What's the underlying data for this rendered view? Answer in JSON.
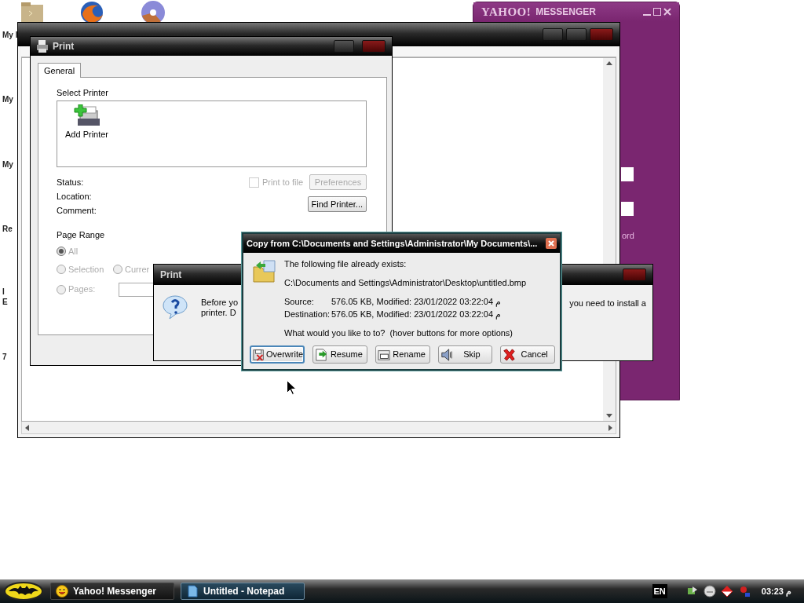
{
  "desktop": {
    "icon_labels": [
      "My I",
      "My",
      "My",
      "Re",
      "I",
      "E",
      "7"
    ]
  },
  "messenger_window": {
    "brand": "YAHOO!",
    "product": "MESSENGER",
    "link_fragment": "ord"
  },
  "print_window": {
    "title": "Print",
    "tabs": [
      {
        "label": "General",
        "selected": true
      }
    ],
    "select_printer_label": "Select Printer",
    "printers": [
      {
        "name": "Add Printer"
      }
    ],
    "info_labels": [
      "Status:",
      "Location:",
      "Comment:"
    ],
    "print_to_file": {
      "label": "Print to file",
      "checked": false,
      "disabled": true
    },
    "buttons": [
      {
        "label": "Preferences",
        "disabled": true
      },
      {
        "label": "Find Printer...",
        "disabled": false
      }
    ],
    "page_range": {
      "title": "Page Range",
      "disabled": true,
      "options": [
        {
          "label": "All",
          "selected": true
        },
        {
          "label": "Selection",
          "selected": false
        },
        {
          "label": "Currer",
          "selected": false
        },
        {
          "label": "Pages:",
          "selected": false
        }
      ]
    }
  },
  "print_message": {
    "title": "Print",
    "text_left": [
      "Before yo",
      "printer. D"
    ],
    "text_right": "you need to install a"
  },
  "copy_dialog": {
    "title": "Copy from C:\\Documents and Settings\\Administrator\\My Documents\\...",
    "heading": "The following file already exists:",
    "path": "C:\\Documents and Settings\\Administrator\\Desktop\\untitled.bmp",
    "details": [
      {
        "label": "Source:",
        "value": "576.05 KB, Modified: 23/01/2022 03:22:04 م"
      },
      {
        "label": "Destination:",
        "value": "576.05 KB, Modified: 23/01/2022 03:22:04 م"
      }
    ],
    "question": "What would you like to to?  (hover buttons for more options)",
    "buttons": [
      {
        "label": "Overwrite",
        "kind": "overwrite",
        "focused": true
      },
      {
        "label": "Resume",
        "kind": "resume",
        "focused": false
      },
      {
        "label": "Rename",
        "kind": "rename",
        "focused": false
      },
      {
        "label": "Skip",
        "kind": "skip",
        "focused": false
      },
      {
        "label": "Cancel",
        "kind": "cancel",
        "focused": false
      }
    ]
  },
  "taskbar": {
    "tasks": [
      {
        "label": "Yahoo! Messenger",
        "kind": "messenger",
        "selected": false
      },
      {
        "label": "Untitled - Notepad",
        "kind": "notepad",
        "selected": true
      }
    ],
    "language": "EN",
    "clock": "03:23 م"
  }
}
